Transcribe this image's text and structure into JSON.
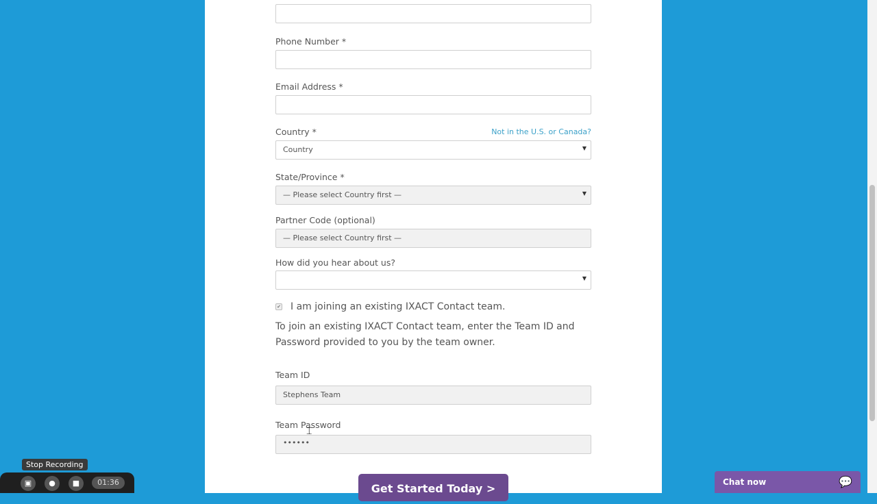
{
  "form": {
    "phone_label": "Phone Number *",
    "email_label": "Email Address *",
    "country_label": "Country *",
    "country_link": "Not in the U.S. or Canada?",
    "country_value": "Country",
    "state_label": "State/Province *",
    "state_value": "— Please select Country first —",
    "partner_label": "Partner Code (optional)",
    "partner_value": "— Please select Country first —",
    "hear_label": "How did you hear about us?",
    "hear_value": "",
    "team_checkbox_label": "I am joining an existing IXACT Contact team.",
    "team_instructions": "To join an existing IXACT Contact team, enter the Team ID and Password provided to you by the team owner.",
    "team_id_label": "Team ID",
    "team_id_value": "Stephens Team",
    "team_password_label": "Team Password",
    "team_password_value": "••••••",
    "submit_label": "Get Started Today >"
  },
  "recorder": {
    "stop_label": "Stop Recording",
    "time": "01:36"
  },
  "chat": {
    "label": "Chat now",
    "icon": "chat-bubble-icon"
  },
  "colors": {
    "background": "#1e9bd7",
    "submit": "#6b4a8f",
    "chat": "#7a57a8",
    "link": "#3aa0c8"
  }
}
